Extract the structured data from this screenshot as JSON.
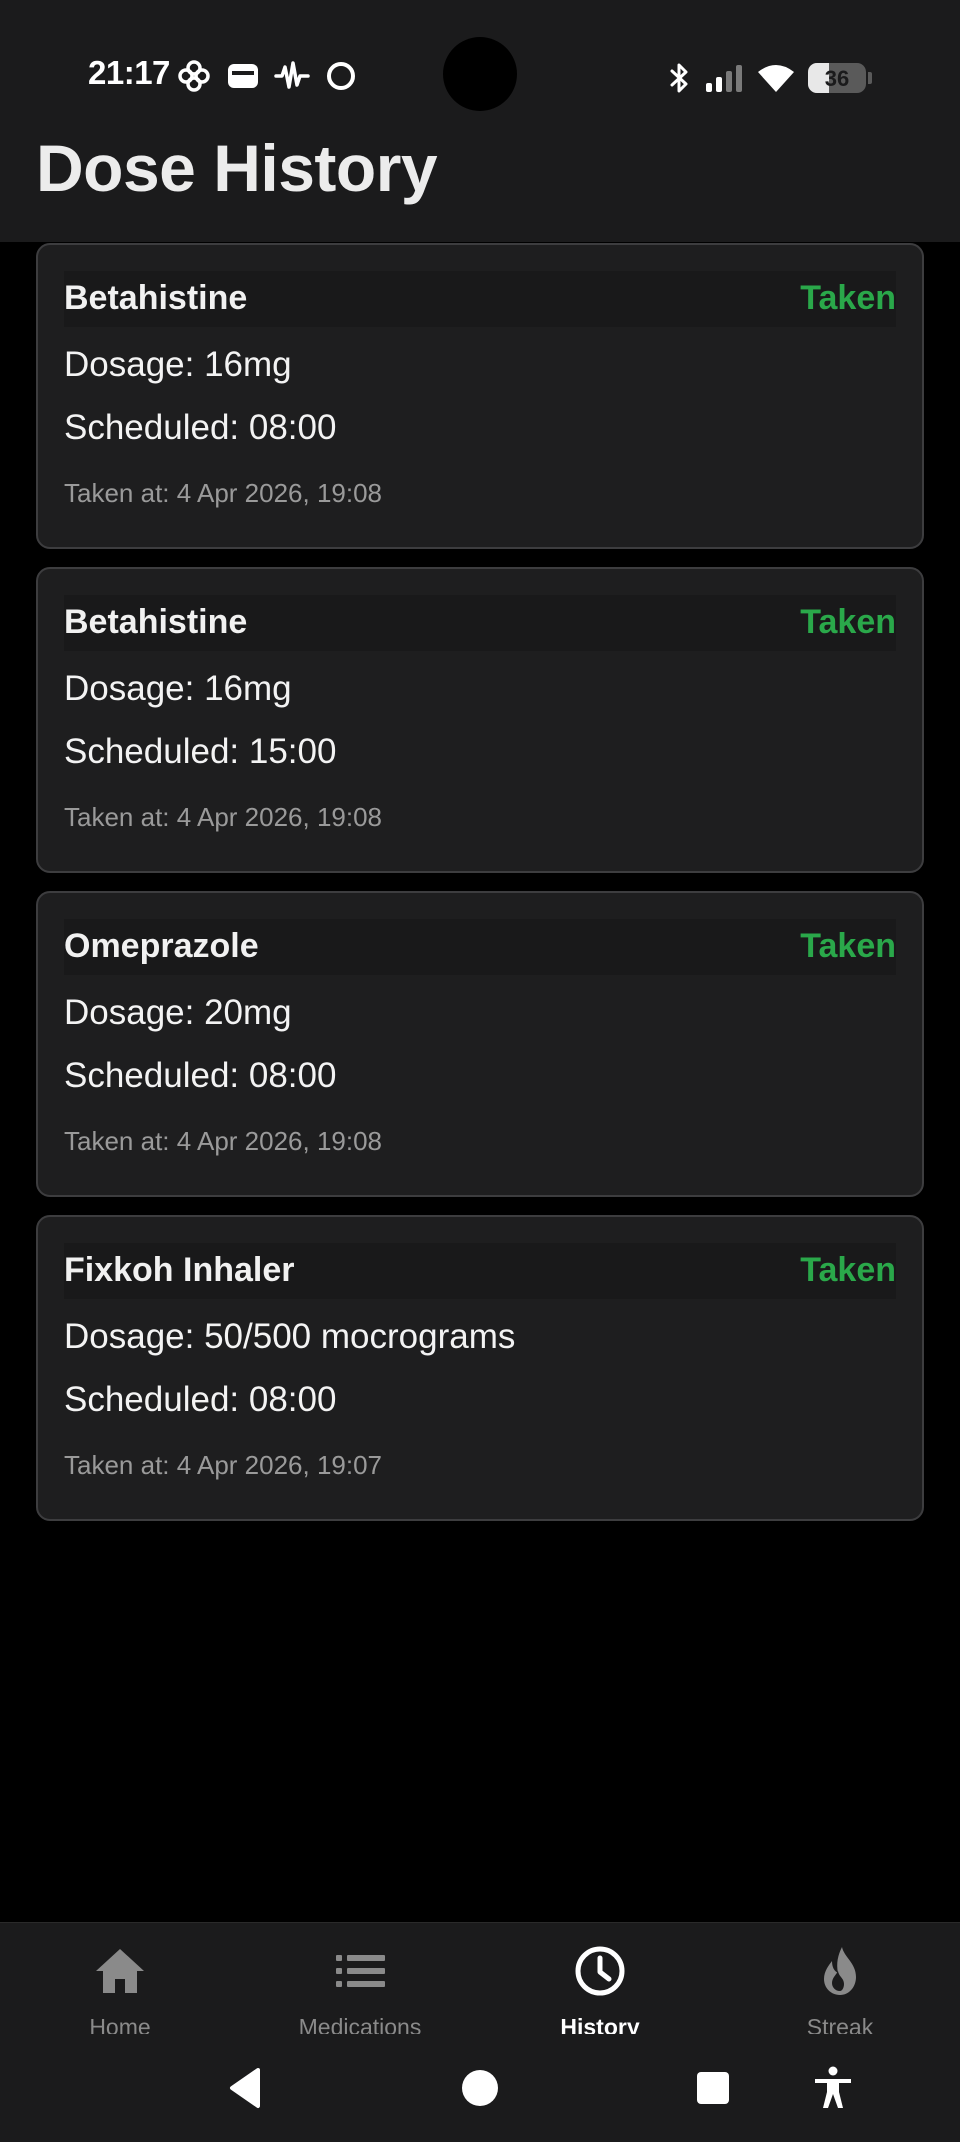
{
  "status_bar": {
    "time": "21:17",
    "battery": "36",
    "battery_level_percent": 36,
    "left_icons": [
      "pinwheel-icon",
      "wallet-icon",
      "activity-icon",
      "circle-icon"
    ],
    "right_icons": [
      "bluetooth-icon",
      "signal-icon",
      "wifi-icon",
      "battery-icon"
    ]
  },
  "header": {
    "title": "Dose History"
  },
  "doses": [
    {
      "name": "Betahistine",
      "status": "Taken",
      "dosage": "Dosage: 16mg",
      "scheduled": "Scheduled: 08:00",
      "taken_at": "Taken at: 4 Apr 2026, 19:08"
    },
    {
      "name": "Betahistine",
      "status": "Taken",
      "dosage": "Dosage: 16mg",
      "scheduled": "Scheduled: 15:00",
      "taken_at": "Taken at: 4 Apr 2026, 19:08"
    },
    {
      "name": "Omeprazole",
      "status": "Taken",
      "dosage": "Dosage: 20mg",
      "scheduled": "Scheduled: 08:00",
      "taken_at": "Taken at: 4 Apr 2026, 19:08"
    },
    {
      "name": "Fixkoh Inhaler",
      "status": "Taken",
      "dosage": "Dosage: 50/500 mocrograms",
      "scheduled": "Scheduled: 08:00",
      "taken_at": "Taken at: 4 Apr 2026, 19:07"
    }
  ],
  "bottom_nav": {
    "items": [
      {
        "label": "Home",
        "icon": "home-icon"
      },
      {
        "label": "Medications",
        "icon": "list-icon"
      },
      {
        "label": "History",
        "icon": "clock-icon",
        "active": true
      },
      {
        "label": "Streak",
        "icon": "flame-icon"
      }
    ]
  },
  "system_nav": {
    "buttons": [
      "back-icon",
      "home-circle-icon",
      "recents-icon",
      "accessibility-icon"
    ]
  },
  "colors": {
    "background": "#000000",
    "header": "#1b1b1c",
    "card": "#1e1e1f",
    "card_border": "#3d3d3f",
    "taken": "#2aa84a",
    "muted_text": "#9a9a9a"
  }
}
